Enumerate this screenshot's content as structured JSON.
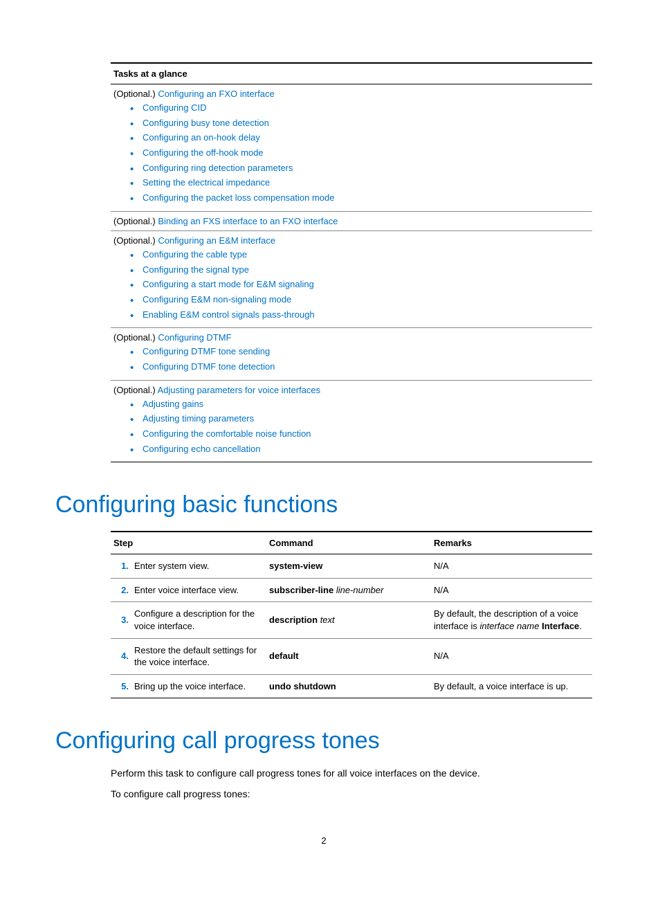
{
  "tasks_header": "Tasks at a glance",
  "group1": {
    "prefix": "(Optional.) ",
    "link": "Configuring an FXO interface",
    "items": [
      "Configuring CID",
      "Configuring busy tone detection",
      "Configuring an on-hook delay",
      "Configuring the off-hook mode",
      "Configuring ring detection parameters",
      "Setting the electrical impedance",
      "Configuring the packet loss compensation mode"
    ]
  },
  "group2": {
    "prefix": "(Optional.) ",
    "link": "Binding an FXS interface to an FXO interface"
  },
  "group3": {
    "prefix": "(Optional.) ",
    "link": "Configuring an E&M interface",
    "items": [
      "Configuring the cable type",
      "Configuring the signal type",
      "Configuring a start mode for E&M signaling",
      "Configuring E&M non-signaling mode",
      "Enabling E&M control signals pass-through"
    ]
  },
  "group4": {
    "prefix": "(Optional.) ",
    "link": "Configuring DTMF",
    "items": [
      "Configuring DTMF tone sending",
      "Configuring DTMF tone detection"
    ]
  },
  "group5": {
    "prefix": "(Optional.) ",
    "link": "Adjusting parameters for voice interfaces",
    "items": [
      "Adjusting gains",
      "Adjusting timing parameters",
      "Configuring the comfortable noise function",
      "Configuring echo cancellation"
    ]
  },
  "heading1": "Configuring basic functions",
  "steps_headers": {
    "step": "Step",
    "command": "Command",
    "remarks": "Remarks"
  },
  "steps": [
    {
      "n": "1.",
      "desc": "Enter system view.",
      "cmd_bold": "system-view",
      "cmd_italic": "",
      "remarks_plain": "N/A"
    },
    {
      "n": "2.",
      "desc": "Enter voice interface view.",
      "cmd_bold": "subscriber-line ",
      "cmd_italic": "line-number",
      "remarks_plain": "N/A"
    },
    {
      "n": "3.",
      "desc": "Configure a description for the voice interface.",
      "cmd_bold": "description ",
      "cmd_italic": "text",
      "remarks_pre": "By default, the description of a voice interface is ",
      "remarks_italic": "interface name",
      "remarks_post_bold": " Interface",
      "remarks_tail": "."
    },
    {
      "n": "4.",
      "desc": "Restore the default settings for the voice interface.",
      "cmd_bold": "default",
      "cmd_italic": "",
      "remarks_plain": "N/A"
    },
    {
      "n": "5.",
      "desc": "Bring up the voice interface.",
      "cmd_bold": "undo shutdown",
      "cmd_italic": "",
      "remarks_plain": "By default, a voice interface is up."
    }
  ],
  "heading2": "Configuring call progress tones",
  "para1": "Perform this task to configure call progress tones for all voice interfaces on the device.",
  "para2": "To configure call progress tones:",
  "pagenum": "2"
}
